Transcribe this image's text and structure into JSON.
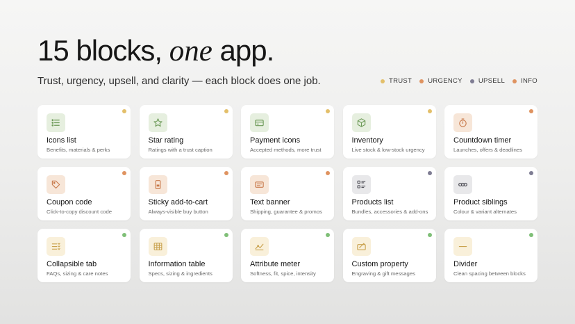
{
  "header": {
    "title_part1": "15 blocks, ",
    "title_em": "one",
    "title_part2": " app.",
    "subtitle": "Trust, urgency, upsell, and clarity — each block does one job."
  },
  "legend": [
    {
      "label": "TRUST",
      "color": "#e3bf6a"
    },
    {
      "label": "URGENCY",
      "color": "#df9360"
    },
    {
      "label": "UPSELL",
      "color": "#7f7d93"
    },
    {
      "label": "INFO",
      "color": "#df9360"
    }
  ],
  "cards": [
    {
      "title": "Icons list",
      "desc": "Benefits, materials & perks",
      "icon": "list-icon",
      "icon_bg": "#e6efdf",
      "icon_color": "#6d9a58",
      "dot": "#e3bf6a"
    },
    {
      "title": "Star rating",
      "desc": "Ratings with a trust caption",
      "icon": "star-icon",
      "icon_bg": "#e6efdf",
      "icon_color": "#6d9a58",
      "dot": "#e3bf6a"
    },
    {
      "title": "Payment icons",
      "desc": "Accepted methods, more trust",
      "icon": "credit-card-icon",
      "icon_bg": "#e6efdf",
      "icon_color": "#6d9a58",
      "dot": "#e3bf6a"
    },
    {
      "title": "Inventory",
      "desc": "Live stock & low-stock urgency",
      "icon": "box-icon",
      "icon_bg": "#e6efdf",
      "icon_color": "#6d9a58",
      "dot": "#e3bf6a"
    },
    {
      "title": "Countdown timer",
      "desc": "Launches, offers & deadlines",
      "icon": "timer-icon",
      "icon_bg": "#f7e6d8",
      "icon_color": "#c8794a",
      "dot": "#df9360"
    },
    {
      "title": "Coupon code",
      "desc": "Click-to-copy discount code",
      "icon": "tag-icon",
      "icon_bg": "#f7e6d8",
      "icon_color": "#c8794a",
      "dot": "#df9360"
    },
    {
      "title": "Sticky add-to-cart",
      "desc": "Always-visible buy button",
      "icon": "phone-icon",
      "icon_bg": "#f7e6d8",
      "icon_color": "#c8794a",
      "dot": "#df9360"
    },
    {
      "title": "Text banner",
      "desc": "Shipping, guarantee & promos",
      "icon": "banner-icon",
      "icon_bg": "#f7e6d8",
      "icon_color": "#c8794a",
      "dot": "#df9360"
    },
    {
      "title": "Products list",
      "desc": "Bundles, accessories & add-ons",
      "icon": "grid-list-icon",
      "icon_bg": "#e8e8ea",
      "icon_color": "#4d4d55",
      "dot": "#7f7d93"
    },
    {
      "title": "Product siblings",
      "desc": "Colour & variant alternates",
      "icon": "link-icon",
      "icon_bg": "#e8e8ea",
      "icon_color": "#4d4d55",
      "dot": "#7f7d93"
    },
    {
      "title": "Collapsible tab",
      "desc": "FAQs, sizing & care notes",
      "icon": "collapse-list-icon",
      "icon_bg": "#f9f0da",
      "icon_color": "#c9a24e",
      "dot": "#7fbf77"
    },
    {
      "title": "Information table",
      "desc": "Specs, sizing & ingredients",
      "icon": "table-icon",
      "icon_bg": "#f9f0da",
      "icon_color": "#c9a24e",
      "dot": "#7fbf77"
    },
    {
      "title": "Attribute meter",
      "desc": "Softness, fit, spice, intensity",
      "icon": "meter-icon",
      "icon_bg": "#f9f0da",
      "icon_color": "#c9a24e",
      "dot": "#7fbf77"
    },
    {
      "title": "Custom property",
      "desc": "Engraving & gift messages",
      "icon": "custom-property-icon",
      "icon_bg": "#f9f0da",
      "icon_color": "#c9a24e",
      "dot": "#7fbf77"
    },
    {
      "title": "Divider",
      "desc": "Clean spacing between blocks",
      "icon": "divider-icon",
      "icon_bg": "#f9f0da",
      "icon_color": "#c9a24e",
      "dot": "#7fbf77"
    }
  ]
}
